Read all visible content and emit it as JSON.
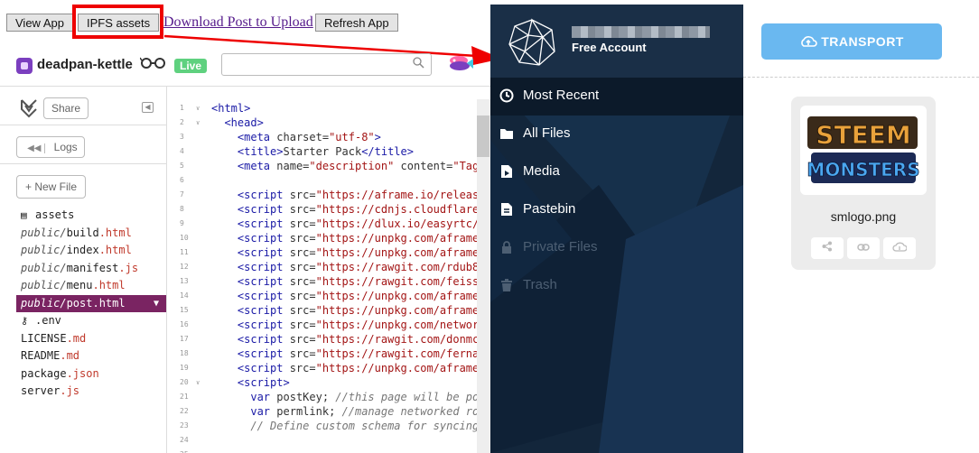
{
  "toolbar": {
    "view_app": "View App",
    "ipfs_assets": "IPFS assets",
    "download_post": "Download Post to Upload",
    "refresh_app": "Refresh App"
  },
  "project": {
    "name": "deadpan-kettle",
    "live_badge": "Live",
    "search_placeholder": ""
  },
  "sidebar": {
    "share": "Share",
    "logs": "Logs",
    "new_file": "+ New File",
    "files": [
      {
        "dir": "",
        "base": "assets",
        "ext": "",
        "icon": "archive-icon"
      },
      {
        "dir": "public/",
        "base": "build",
        "ext": ".html"
      },
      {
        "dir": "public/",
        "base": "index",
        "ext": ".html"
      },
      {
        "dir": "public/",
        "base": "manifest",
        "ext": ".js"
      },
      {
        "dir": "public/",
        "base": "menu",
        "ext": ".html"
      },
      {
        "dir": "public/",
        "base": "post",
        "ext": ".html",
        "selected": true
      },
      {
        "dir": "",
        "base": ".env",
        "ext": "",
        "icon": "key-icon"
      },
      {
        "dir": "",
        "base": "LICENSE",
        "ext": ".md"
      },
      {
        "dir": "",
        "base": "README",
        "ext": ".md"
      },
      {
        "dir": "",
        "base": "package",
        "ext": ".json"
      },
      {
        "dir": "",
        "base": "server",
        "ext": ".js"
      }
    ]
  },
  "editor": {
    "lines": [
      {
        "n": "1",
        "fold": true,
        "segs": [
          [
            "tag",
            "<html>"
          ]
        ]
      },
      {
        "n": "2",
        "fold": true,
        "segs": [
          [
            "plain",
            "  "
          ],
          [
            "tag",
            "<head>"
          ]
        ]
      },
      {
        "n": "3",
        "segs": [
          [
            "plain",
            "    "
          ],
          [
            "tag",
            "<meta "
          ],
          [
            "attr",
            "charset"
          ],
          [
            "plain",
            "="
          ],
          [
            "str",
            "\"utf-8\""
          ],
          [
            "tag",
            ">"
          ]
        ]
      },
      {
        "n": "4",
        "segs": [
          [
            "plain",
            "    "
          ],
          [
            "tag",
            "<title>"
          ],
          [
            "plain",
            "Starter Pack"
          ],
          [
            "tag",
            "</title>"
          ]
        ]
      },
      {
        "n": "5",
        "segs": [
          [
            "plain",
            "    "
          ],
          [
            "tag",
            "<meta "
          ],
          [
            "attr",
            "name"
          ],
          [
            "plain",
            "="
          ],
          [
            "str",
            "\"description\""
          ],
          [
            "attr",
            " content"
          ],
          [
            "plain",
            "="
          ],
          [
            "str",
            "\"Tag"
          ]
        ]
      },
      {
        "n": "6",
        "segs": []
      },
      {
        "n": "7",
        "segs": [
          [
            "plain",
            "    "
          ],
          [
            "tag",
            "<script "
          ],
          [
            "attr",
            "src"
          ],
          [
            "plain",
            "="
          ],
          [
            "str",
            "\"https://aframe.io/release"
          ]
        ]
      },
      {
        "n": "8",
        "segs": [
          [
            "plain",
            "    "
          ],
          [
            "tag",
            "<script "
          ],
          [
            "attr",
            "src"
          ],
          [
            "plain",
            "="
          ],
          [
            "str",
            "\"https://cdnjs.cloudflare."
          ]
        ]
      },
      {
        "n": "9",
        "segs": [
          [
            "plain",
            "    "
          ],
          [
            "tag",
            "<script "
          ],
          [
            "attr",
            "src"
          ],
          [
            "plain",
            "="
          ],
          [
            "str",
            "\"https://dlux.io/easyrtc/e"
          ]
        ]
      },
      {
        "n": "10",
        "segs": [
          [
            "plain",
            "    "
          ],
          [
            "tag",
            "<script "
          ],
          [
            "attr",
            "src"
          ],
          [
            "plain",
            "="
          ],
          [
            "str",
            "\"https://unpkg.com/aframe-"
          ]
        ]
      },
      {
        "n": "11",
        "segs": [
          [
            "plain",
            "    "
          ],
          [
            "tag",
            "<script "
          ],
          [
            "attr",
            "src"
          ],
          [
            "plain",
            "="
          ],
          [
            "str",
            "\"https://unpkg.com/aframe-"
          ]
        ]
      },
      {
        "n": "12",
        "segs": [
          [
            "plain",
            "    "
          ],
          [
            "tag",
            "<script "
          ],
          [
            "attr",
            "src"
          ],
          [
            "plain",
            "="
          ],
          [
            "str",
            "\"https://rawgit.com/rdub80"
          ]
        ]
      },
      {
        "n": "13",
        "segs": [
          [
            "plain",
            "    "
          ],
          [
            "tag",
            "<script "
          ],
          [
            "attr",
            "src"
          ],
          [
            "plain",
            "="
          ],
          [
            "str",
            "\"https://rawgit.com/feiss/"
          ]
        ]
      },
      {
        "n": "14",
        "segs": [
          [
            "plain",
            "    "
          ],
          [
            "tag",
            "<script "
          ],
          [
            "attr",
            "src"
          ],
          [
            "plain",
            "="
          ],
          [
            "str",
            "\"https://unpkg.com/aframe-"
          ]
        ]
      },
      {
        "n": "15",
        "segs": [
          [
            "plain",
            "    "
          ],
          [
            "tag",
            "<script "
          ],
          [
            "attr",
            "src"
          ],
          [
            "plain",
            "="
          ],
          [
            "str",
            "\"https://unpkg.com/aframe-"
          ]
        ]
      },
      {
        "n": "16",
        "segs": [
          [
            "plain",
            "    "
          ],
          [
            "tag",
            "<script "
          ],
          [
            "attr",
            "src"
          ],
          [
            "plain",
            "="
          ],
          [
            "str",
            "\"https://unpkg.com/network"
          ]
        ]
      },
      {
        "n": "17",
        "segs": [
          [
            "plain",
            "    "
          ],
          [
            "tag",
            "<script "
          ],
          [
            "attr",
            "src"
          ],
          [
            "plain",
            "="
          ],
          [
            "str",
            "\"https://rawgit.com/donmcc"
          ]
        ]
      },
      {
        "n": "18",
        "segs": [
          [
            "plain",
            "    "
          ],
          [
            "tag",
            "<script "
          ],
          [
            "attr",
            "src"
          ],
          [
            "plain",
            "="
          ],
          [
            "str",
            "\"https://rawgit.com/fernan"
          ]
        ]
      },
      {
        "n": "19",
        "segs": [
          [
            "plain",
            "    "
          ],
          [
            "tag",
            "<script "
          ],
          [
            "attr",
            "src"
          ],
          [
            "plain",
            "="
          ],
          [
            "str",
            "\"https://unpkg.com/aframe-"
          ]
        ]
      },
      {
        "n": "20",
        "fold": true,
        "segs": [
          [
            "plain",
            "    "
          ],
          [
            "tag",
            "<script>"
          ]
        ]
      },
      {
        "n": "21",
        "segs": [
          [
            "plain",
            "      "
          ],
          [
            "kw",
            "var"
          ],
          [
            "plain",
            " postKey; "
          ],
          [
            "com",
            "//this page will be pos"
          ]
        ]
      },
      {
        "n": "22",
        "segs": [
          [
            "plain",
            "      "
          ],
          [
            "kw",
            "var"
          ],
          [
            "plain",
            " permlink; "
          ],
          [
            "com",
            "//manage networked roo"
          ]
        ]
      },
      {
        "n": "23",
        "segs": [
          [
            "plain",
            "      "
          ],
          [
            "com",
            "// Define custom schema for syncing"
          ]
        ]
      },
      {
        "n": "24",
        "segs": []
      },
      {
        "n": "25",
        "segs": []
      }
    ]
  },
  "account": {
    "type": "Free Account"
  },
  "nav": [
    {
      "label": "Most Recent",
      "icon": "clock-icon",
      "active": true
    },
    {
      "label": "All Files",
      "icon": "folder-icon"
    },
    {
      "label": "Media",
      "icon": "media-icon"
    },
    {
      "label": "Pastebin",
      "icon": "pastebin-icon"
    },
    {
      "label": "Private Files",
      "icon": "lock-icon",
      "disabled": true
    },
    {
      "label": "Trash",
      "icon": "trash-icon",
      "disabled": true
    }
  ],
  "transport": {
    "label": "TRANSPORT"
  },
  "file_card": {
    "name": "smlogo.png",
    "logo_line1": "STEEM",
    "logo_line2": "MONSTERS"
  },
  "colors": {
    "highlight": "#ee0000",
    "selected_file": "#7a2462",
    "dark_panel": "#13263b",
    "transport": "#6ab8f0",
    "live": "#5fd17f"
  }
}
